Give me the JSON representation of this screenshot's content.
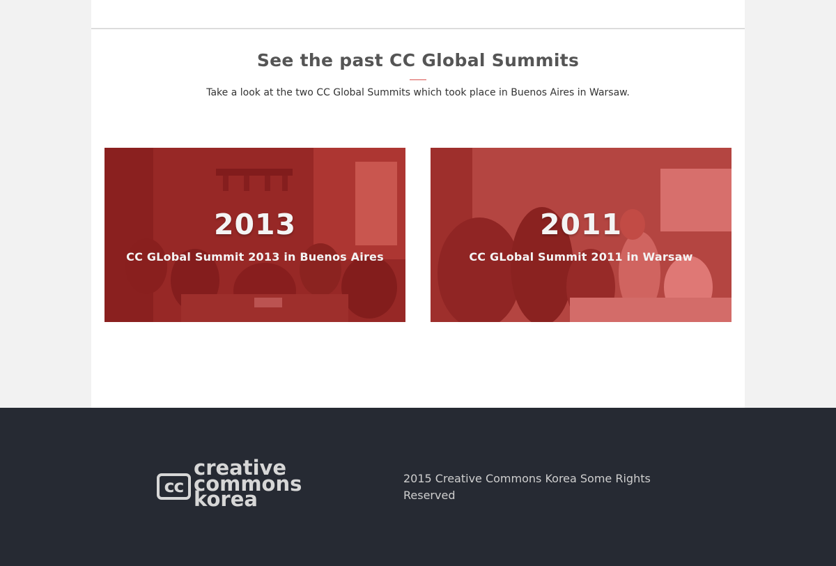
{
  "section": {
    "title": "See the past CC Global Summits",
    "subtitle": "Take a look at the two CC Global Summits which took place in Buenos Aires in Warsaw."
  },
  "cards": [
    {
      "year": "2013",
      "caption": "CC GLobal Summit 2013 in Buenos Aires"
    },
    {
      "year": "2011",
      "caption": "CC GLobal Summit 2011 in Warsaw"
    }
  ],
  "footer": {
    "logo": {
      "mark": "cc",
      "line1": "creative",
      "line2": "commons",
      "line3": "korea"
    },
    "copyright": "2015 Creative Commons Korea Some Rights Reserved"
  },
  "colors": {
    "accent": "#d9534f",
    "overlay": "#d72626",
    "footer_bg": "#262a33"
  }
}
